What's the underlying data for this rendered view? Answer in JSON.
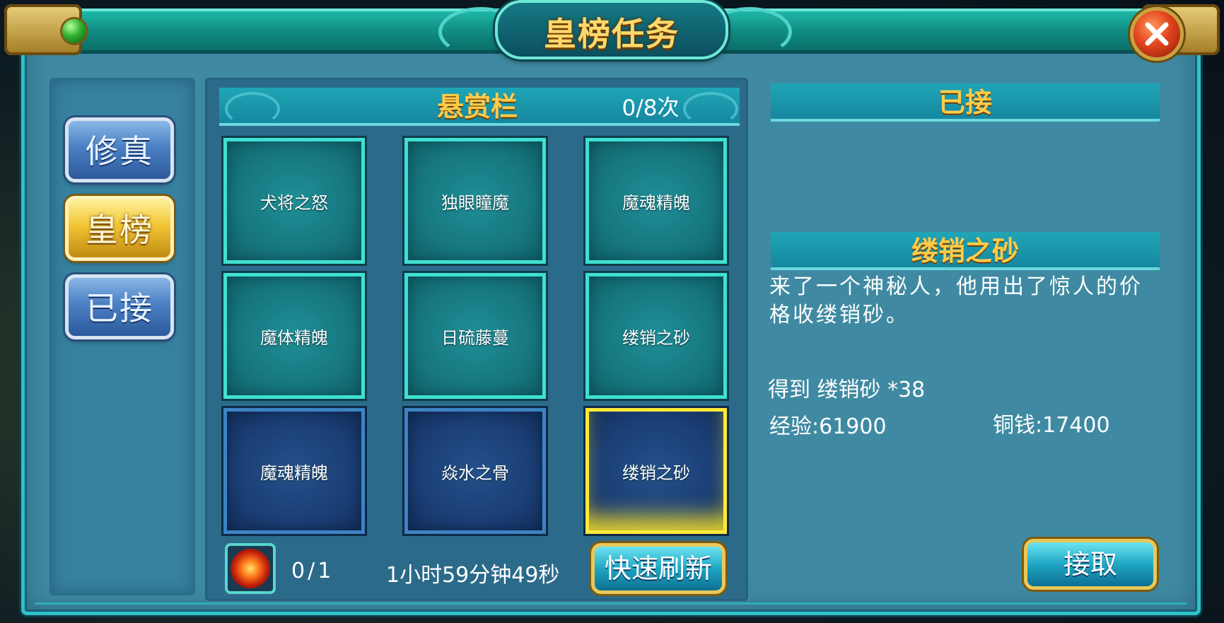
{
  "window": {
    "title": "皇榜任务"
  },
  "tabs": [
    {
      "label": "修真",
      "state": "normal"
    },
    {
      "label": "皇榜",
      "state": "active"
    },
    {
      "label": "已接",
      "state": "normal"
    }
  ],
  "board": {
    "title": "悬赏栏",
    "count": "0/8次",
    "tasks": [
      {
        "name": "犬将之怒",
        "style": "teal"
      },
      {
        "name": "独眼瞳魔",
        "style": "teal"
      },
      {
        "name": "魔魂精魄",
        "style": "teal"
      },
      {
        "name": "魔体精魄",
        "style": "teal"
      },
      {
        "name": "日硫藤蔓",
        "style": "teal"
      },
      {
        "name": "缕销之砂",
        "style": "teal"
      },
      {
        "name": "魔魂精魄",
        "style": "navy"
      },
      {
        "name": "焱水之骨",
        "style": "navy"
      },
      {
        "name": "缕销之砂",
        "style": "navy",
        "selected": true
      }
    ],
    "item_count": "0/1",
    "timer": "1小时59分钟49秒",
    "refresh_label": "快速刷新"
  },
  "detail": {
    "accepted_header": "已接",
    "task_title": "缕销之砂",
    "description": "来了一个神秘人，他用出了惊人的价格收缕销砂。",
    "reward_item": "得到 缕销砂 *38",
    "exp": "经验:61900",
    "coin": "铜钱:17400",
    "accept_label": "接取"
  },
  "colors": {
    "frame": "#3f8aa2",
    "title_gold": "#ffd86a",
    "header_gold": "#ffcc4a",
    "selected_border": "#ffe93a"
  },
  "icons": [
    "green-gem-icon",
    "close-icon",
    "fire-orb-icon"
  ]
}
